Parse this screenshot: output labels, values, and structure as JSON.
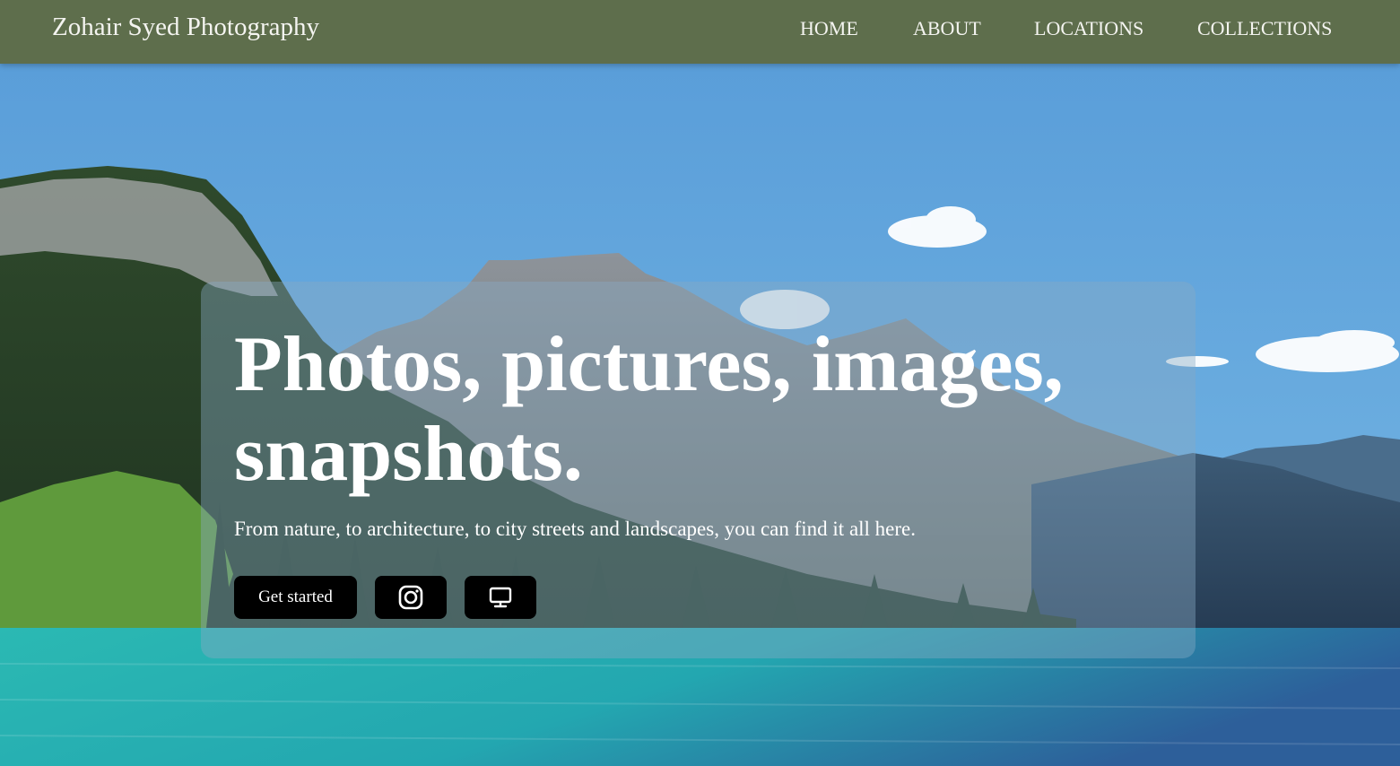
{
  "navbar": {
    "brand": "Zohair Syed Photography",
    "links": [
      {
        "label": "HOME"
      },
      {
        "label": "ABOUT"
      },
      {
        "label": "LOCATIONS"
      },
      {
        "label": "COLLECTIONS"
      }
    ],
    "background": "#5e6e4c"
  },
  "hero": {
    "title": "Photos, pictures, images, snapshots.",
    "subtitle": "From nature, to architecture, to city streets and landscapes, you can find it all here.",
    "buttons": {
      "start_label": "Get started",
      "instagram_icon": "instagram-icon",
      "desktop_icon": "desktop-monitor-icon"
    }
  },
  "colors": {
    "sky": "#63a3d8",
    "lake": "#2fb3b0",
    "button": "#000000"
  }
}
